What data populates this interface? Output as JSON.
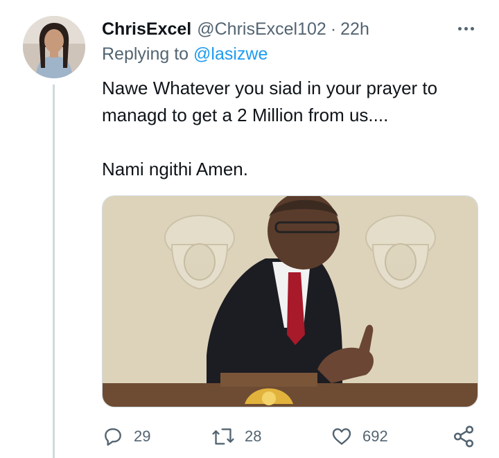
{
  "tweet": {
    "display_name": "ChrisExcel",
    "handle": "@ChrisExcel102",
    "separator": "·",
    "time": "22h",
    "replying_label": "Replying to ",
    "replying_to": "@lasizwe",
    "text_line_1": "Nawe Whatever you siad in your prayer to",
    "text_line_2": "managd to get a 2 Million from us....",
    "text_line_3": "Nami ngithi Amen."
  },
  "media": {
    "description_icon": "photo"
  },
  "actions": {
    "replies": "29",
    "retweets": "28",
    "likes": "692"
  },
  "colors": {
    "accent": "#1d9bf0",
    "secondary_text": "#536471",
    "primary_text": "#0f1419",
    "thread_line": "#cfd9de"
  }
}
